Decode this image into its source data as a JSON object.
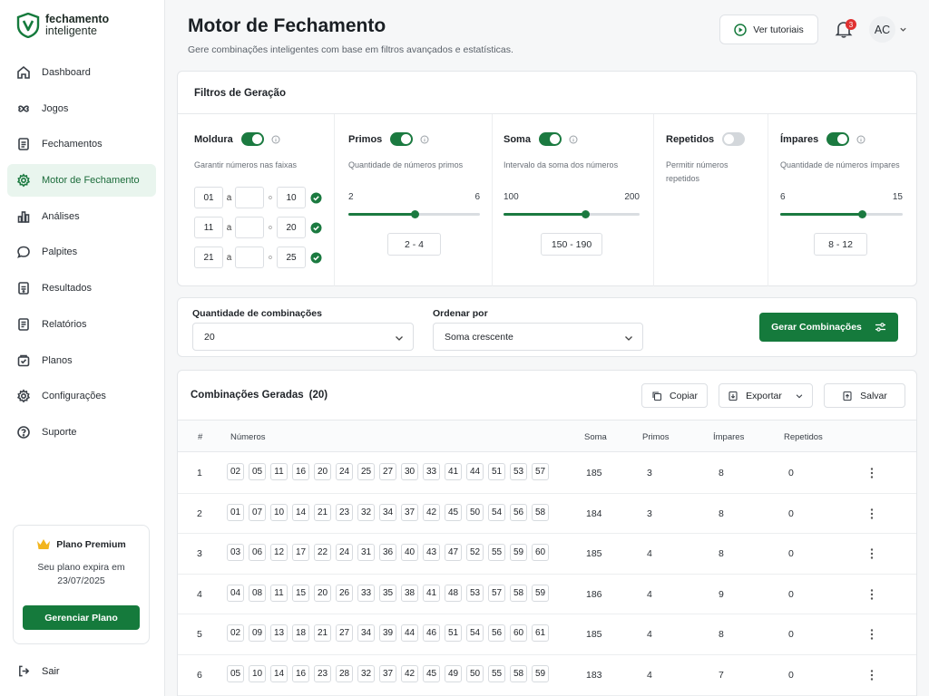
{
  "brand": {
    "line1": "fechamento",
    "line2": "inteligente"
  },
  "nav": [
    {
      "label": "Dashboard",
      "icon": "home-icon",
      "active": false
    },
    {
      "label": "Jogos",
      "icon": "clover-icon",
      "active": false
    },
    {
      "label": "Fechamentos",
      "icon": "document-list-icon",
      "active": false
    },
    {
      "label": "Motor de Fechamento",
      "icon": "gear-icon",
      "active": true
    },
    {
      "label": "Análises",
      "icon": "bar-chart-icon",
      "active": false
    },
    {
      "label": "Palpites",
      "icon": "chat-bubble-icon",
      "active": false
    },
    {
      "label": "Resultados",
      "icon": "results-doc-icon",
      "active": false
    },
    {
      "label": "Relatórios",
      "icon": "report-icon",
      "active": false
    },
    {
      "label": "Planos",
      "icon": "box-check-icon",
      "active": false
    },
    {
      "label": "Configurações",
      "icon": "settings-icon",
      "active": false
    },
    {
      "label": "Suporte",
      "icon": "support-icon",
      "active": false
    }
  ],
  "plan": {
    "title": "Plano Premium",
    "line1": "Seu plano expira em",
    "line2": "23/07/2025",
    "button": "Gerenciar Plano"
  },
  "logout": "Sair",
  "header": {
    "title": "Motor de Fechamento",
    "subtitle": "Gere combinações inteligentes com base em filtros avançados e estatísticas.",
    "tutorials": "Ver tutoriais",
    "notifications": "3",
    "avatar": "AC"
  },
  "filters": {
    "title": "Filtros de Geração",
    "moldura": {
      "label": "Moldura",
      "enabled": true,
      "desc": "Garantir números nas faixas",
      "sep_a": "a",
      "sep_o": "o",
      "rows": [
        {
          "from": "01",
          "to": "10"
        },
        {
          "from": "11",
          "to": "20"
        },
        {
          "from": "21",
          "to": "25"
        }
      ]
    },
    "primos": {
      "label": "Primos",
      "enabled": true,
      "desc": "Quantidade de números primos",
      "min": "2",
      "max": "6",
      "value": 4,
      "range_min": 2,
      "range_max": 6,
      "display": "2  -  4"
    },
    "soma": {
      "label": "Soma",
      "enabled": true,
      "desc": "Intervalo da soma dos números",
      "min": "100",
      "max": "200",
      "value": 160,
      "range_min": 100,
      "range_max": 200,
      "display": "150  -  190"
    },
    "repetidos": {
      "label": "Repetidos",
      "enabled": false,
      "desc": "Permitir números repetidos"
    },
    "impares": {
      "label": "Ímpares",
      "enabled": true,
      "desc": "Quantidade de números ímpares",
      "min": "6",
      "max": "15",
      "value": 12,
      "range_min": 6,
      "range_max": 15,
      "display": "8  -  12"
    }
  },
  "options": {
    "qty_label": "Quantidade de combinações",
    "qty_value": "20",
    "order_label": "Ordenar por",
    "order_value": "Soma crescente",
    "generate": "Gerar Combinações"
  },
  "results": {
    "title": "Combinações Geradas",
    "count": "(20)",
    "copy": "Copiar",
    "export": "Exportar",
    "save": "Salvar",
    "columns": {
      "idx": "#",
      "numbers": "Números",
      "sum": "Soma",
      "primes": "Primos",
      "odds": "Ímpares",
      "repeated": "Repetidos"
    },
    "rows": [
      {
        "idx": "1",
        "nums": [
          "02",
          "05",
          "11",
          "16",
          "20",
          "24",
          "25",
          "27",
          "30",
          "33",
          "41",
          "44",
          "51",
          "53",
          "57"
        ],
        "sum": "185",
        "primes": "3",
        "odds": "8",
        "repeated": "0"
      },
      {
        "idx": "2",
        "nums": [
          "01",
          "07",
          "10",
          "14",
          "21",
          "23",
          "32",
          "34",
          "37",
          "42",
          "45",
          "50",
          "54",
          "56",
          "58"
        ],
        "sum": "184",
        "primes": "3",
        "odds": "8",
        "repeated": "0"
      },
      {
        "idx": "3",
        "nums": [
          "03",
          "06",
          "12",
          "17",
          "22",
          "24",
          "31",
          "36",
          "40",
          "43",
          "47",
          "52",
          "55",
          "59",
          "60"
        ],
        "sum": "185",
        "primes": "4",
        "odds": "8",
        "repeated": "0"
      },
      {
        "idx": "4",
        "nums": [
          "04",
          "08",
          "11",
          "15",
          "20",
          "26",
          "33",
          "35",
          "38",
          "41",
          "48",
          "53",
          "57",
          "58",
          "59"
        ],
        "sum": "186",
        "primes": "4",
        "odds": "9",
        "repeated": "0"
      },
      {
        "idx": "5",
        "nums": [
          "02",
          "09",
          "13",
          "18",
          "21",
          "27",
          "34",
          "39",
          "44",
          "46",
          "51",
          "54",
          "56",
          "60",
          "61"
        ],
        "sum": "185",
        "primes": "4",
        "odds": "8",
        "repeated": "0"
      },
      {
        "idx": "6",
        "nums": [
          "05",
          "10",
          "14",
          "16",
          "23",
          "28",
          "32",
          "37",
          "42",
          "45",
          "49",
          "50",
          "55",
          "58",
          "59"
        ],
        "sum": "183",
        "primes": "4",
        "odds": "7",
        "repeated": "0"
      }
    ]
  },
  "colors": {
    "accent": "#157a3c",
    "accent_light": "#e9f5ee",
    "badge": "#e03131"
  }
}
